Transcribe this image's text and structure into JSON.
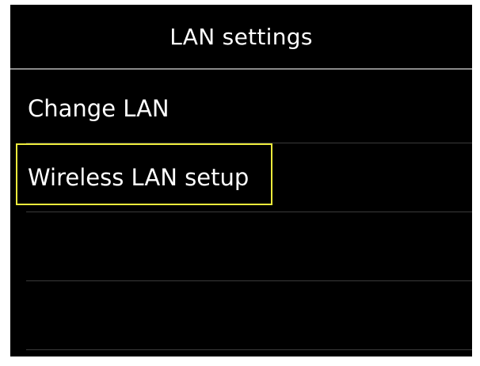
{
  "header": {
    "title": "LAN settings"
  },
  "menu": {
    "items": [
      {
        "label": "Change LAN"
      },
      {
        "label": "Wireless LAN setup"
      },
      {
        "label": ""
      },
      {
        "label": ""
      }
    ],
    "selected_index": 1
  },
  "colors": {
    "background": "#000000",
    "text": "#ffffff",
    "selection_highlight": "#ecea3c",
    "divider": "#3a3a3a"
  }
}
